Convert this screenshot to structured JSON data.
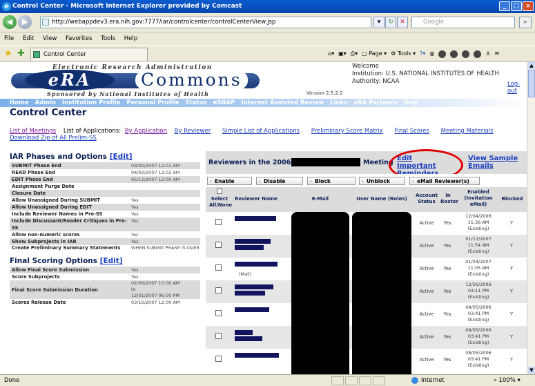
{
  "window": {
    "title": "Control Center - Microsoft Internet Explorer provided by Comcast",
    "address": "http://webappdev3.era.nih.gov:7777/iar/controlcenter/controlCenterView.jsp",
    "search_placeholder": "Google",
    "tab_title": "Control Center",
    "status_text": "Done",
    "zone": "Internet",
    "zoom": "100%"
  },
  "menu": [
    "File",
    "Edit",
    "View",
    "Favorites",
    "Tools",
    "Help"
  ],
  "cmdbar": {
    "page": "Page",
    "tools": "Tools"
  },
  "header": {
    "logo_top": "Electronic Research Administration",
    "logo_era": "eRA",
    "logo_commons": "Commons",
    "logo_bottom": "Sponsored by National Institutes of Health",
    "version": "Version 2.5.2.2",
    "welcome": "Welcome",
    "institution": "Institution: U.S. NATIONAL INSTITUTES OF HEALTH",
    "authority": "Authority:   NCAA",
    "logout": "Log-out"
  },
  "nav": [
    "Home",
    "Admin",
    "Institution Profile",
    "Personal Profile",
    "Status",
    "eSNAP",
    "Internet Assisted Review",
    "Links",
    "eRA Partners",
    "Help"
  ],
  "page_title": "Control Center",
  "links": {
    "meetings": "List of Meetings",
    "apps_label": "List of Applications:",
    "by_app": "By Application",
    "by_rev": "By Reviewer",
    "simple": "Simple List of Applications",
    "matrix": "Preliminary Score Matrix",
    "final": "Final Scores",
    "materials": "Meeting Materials",
    "download": "Download Zip of All Prelim-SS"
  },
  "iar": {
    "title": "IAR Phases and Options",
    "edit": "[Edit]",
    "rows": [
      {
        "k": "SUBMIT Phase End",
        "v": "03/02/2007 12:01 AM"
      },
      {
        "k": "READ Phase End",
        "v": "04/02/2007 12:02 AM"
      },
      {
        "k": "EDIT Phase End",
        "v": "05/12/2007 12:00 AM"
      },
      {
        "k": "Assignment Purge Date",
        "v": ""
      },
      {
        "k": "Closure Date",
        "v": ""
      },
      {
        "k": "Allow Unassigned During SUBMIT",
        "v": "Yes"
      },
      {
        "k": "Allow Unassigned During EDIT",
        "v": "Yes"
      },
      {
        "k": "Include Reviewer Names in Pre-SS",
        "v": "Yes"
      },
      {
        "k": "Include Discussant/Reader Critiques in Pre-SS",
        "v": "Yes"
      },
      {
        "k": "Allow non-numeric scores",
        "v": "Yes"
      },
      {
        "k": "Show Subprojects in IAR",
        "v": "Yes"
      },
      {
        "k": "Create Preliminary Summary Statements",
        "v": "WHEN SUBMIT PHASE IS OVER"
      }
    ]
  },
  "final": {
    "title": "Final Scoring Options",
    "edit": "[Edit]",
    "rows": [
      {
        "k": "Allow Final Score Submission",
        "v": "Yes"
      },
      {
        "k": "Score Subprojects",
        "v": "Yes"
      },
      {
        "k": "Final Score Submission Duration",
        "v1": "02/06/2007 10:00 AM",
        "v2": "to",
        "v3": "12/01/2007 06:00 PM"
      },
      {
        "k": "Scores Release Date",
        "v": "03/16/2007 12:00 AM"
      }
    ]
  },
  "reviewers": {
    "title_a": "Reviewers in the 2006/10",
    "title_b": "Meeting",
    "edit_reminders": "Edit Important Reminders",
    "view_sample": "View Sample Emails",
    "buttons": [
      "Enable",
      "Disable",
      "Block",
      "Unblock",
      "eMail Reviewer(s)"
    ],
    "headers": {
      "select": "Select All/None",
      "name": "Reviewer Name",
      "email": "E-Mail",
      "user": "User Name (Roles)",
      "status": "Account Status",
      "roster": "In Roster",
      "enabled": "Enabled (Invitation eMail)",
      "blocked": "Blocked"
    },
    "rows": [
      {
        "status": "Active",
        "roster": "Yes",
        "en1": "12/04/2006",
        "en2": "11:36 AM",
        "en3": "(Existing)",
        "blocked": "Y"
      },
      {
        "status": "Active",
        "roster": "Yes",
        "en1": "01/17/2007",
        "en2": "11:54 AM",
        "en3": "(Existing)",
        "blocked": "Y"
      },
      {
        "status": "Active",
        "roster": "Yes",
        "en1": "01/04/2007",
        "en2": "11:05 AM",
        "en3": "(Existing)",
        "blocked": "Y",
        "mail": "(Mail)"
      },
      {
        "status": "Active",
        "roster": "Yes",
        "en1": "12/26/2006",
        "en2": "03:11 PM",
        "en3": "(Existing)",
        "blocked": "Y"
      },
      {
        "status": "Active",
        "roster": "Yes",
        "en1": "08/05/2006",
        "en2": "03:41 PM",
        "en3": "(Existing)",
        "blocked": "Y"
      },
      {
        "status": "Active",
        "roster": "Yes",
        "en1": "08/05/2006",
        "en2": "03:41 PM",
        "en3": "(Existing)",
        "blocked": "Y"
      },
      {
        "status": "Active",
        "roster": "Yes",
        "en1": "08/05/2006",
        "en2": "03:41 PM",
        "en3": "(Existing)",
        "blocked": "Y"
      }
    ]
  }
}
